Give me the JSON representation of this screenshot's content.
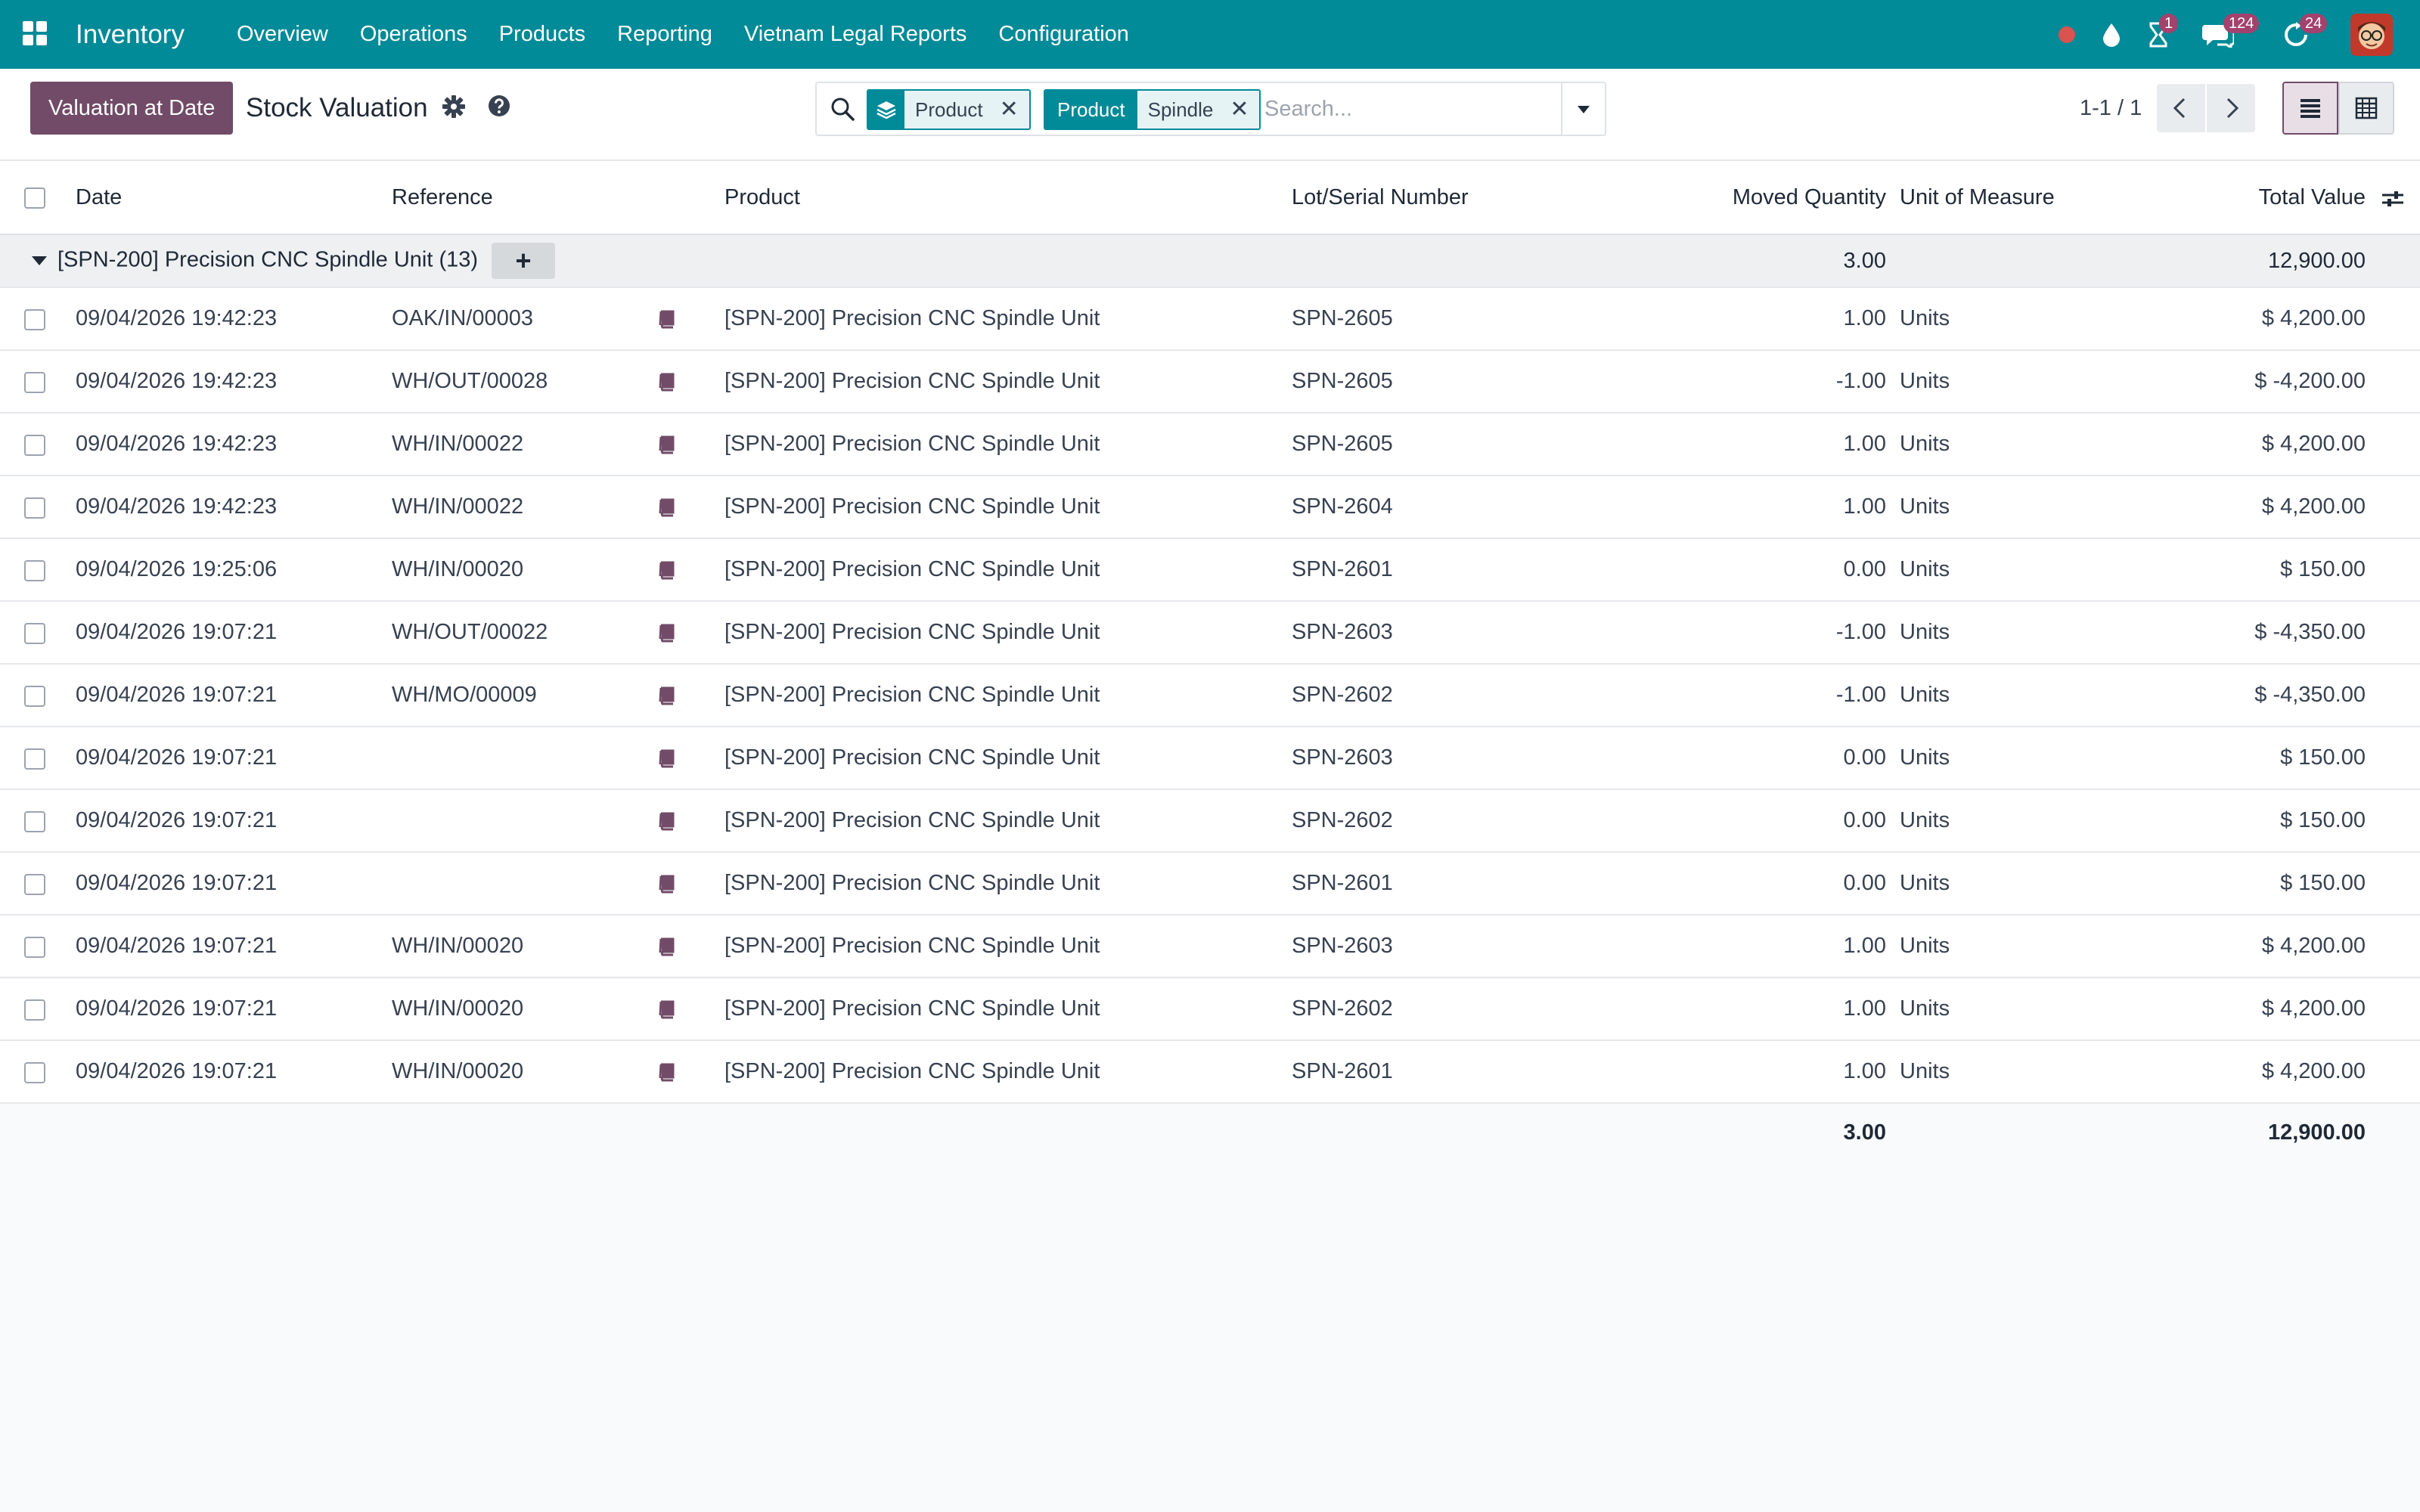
{
  "navbar": {
    "app_name": "Inventory",
    "menu": [
      "Overview",
      "Operations",
      "Products",
      "Reporting",
      "Vietnam Legal Reports",
      "Configuration"
    ],
    "badges": {
      "activities": "1",
      "messages": "124",
      "updates": "24"
    },
    "accent_color": "#018a97"
  },
  "control": {
    "action_button": "Valuation at Date",
    "title": "Stock Valuation",
    "facets": [
      {
        "tag": "",
        "value": "Product"
      },
      {
        "tag": "Product",
        "value": "Spindle"
      }
    ],
    "search_placeholder": "Search...",
    "pager": "1-1 / 1"
  },
  "table": {
    "columns": {
      "date": "Date",
      "reference": "Reference",
      "product": "Product",
      "lot": "Lot/Serial Number",
      "qty": "Moved Quantity",
      "uom": "Unit of Measure",
      "value": "Total Value"
    },
    "group": {
      "label": "[SPN-200] Precision CNC Spindle Unit (13)",
      "qty": "3.00",
      "value": "12,900.00"
    },
    "rows": [
      {
        "date": "09/04/2026 19:42:23",
        "reference": "OAK/IN/00003",
        "product": "[SPN-200] Precision CNC Spindle Unit",
        "lot": "SPN-2605",
        "qty": "1.00",
        "uom": "Units",
        "value": "$ 4,200.00"
      },
      {
        "date": "09/04/2026 19:42:23",
        "reference": "WH/OUT/00028",
        "product": "[SPN-200] Precision CNC Spindle Unit",
        "lot": "SPN-2605",
        "qty": "-1.00",
        "uom": "Units",
        "value": "$ -4,200.00"
      },
      {
        "date": "09/04/2026 19:42:23",
        "reference": "WH/IN/00022",
        "product": "[SPN-200] Precision CNC Spindle Unit",
        "lot": "SPN-2605",
        "qty": "1.00",
        "uom": "Units",
        "value": "$ 4,200.00"
      },
      {
        "date": "09/04/2026 19:42:23",
        "reference": "WH/IN/00022",
        "product": "[SPN-200] Precision CNC Spindle Unit",
        "lot": "SPN-2604",
        "qty": "1.00",
        "uom": "Units",
        "value": "$ 4,200.00"
      },
      {
        "date": "09/04/2026 19:25:06",
        "reference": "WH/IN/00020",
        "product": "[SPN-200] Precision CNC Spindle Unit",
        "lot": "SPN-2601",
        "qty": "0.00",
        "uom": "Units",
        "value": "$ 150.00"
      },
      {
        "date": "09/04/2026 19:07:21",
        "reference": "WH/OUT/00022",
        "product": "[SPN-200] Precision CNC Spindle Unit",
        "lot": "SPN-2603",
        "qty": "-1.00",
        "uom": "Units",
        "value": "$ -4,350.00"
      },
      {
        "date": "09/04/2026 19:07:21",
        "reference": "WH/MO/00009",
        "product": "[SPN-200] Precision CNC Spindle Unit",
        "lot": "SPN-2602",
        "qty": "-1.00",
        "uom": "Units",
        "value": "$ -4,350.00"
      },
      {
        "date": "09/04/2026 19:07:21",
        "reference": "",
        "product": "[SPN-200] Precision CNC Spindle Unit",
        "lot": "SPN-2603",
        "qty": "0.00",
        "uom": "Units",
        "value": "$ 150.00"
      },
      {
        "date": "09/04/2026 19:07:21",
        "reference": "",
        "product": "[SPN-200] Precision CNC Spindle Unit",
        "lot": "SPN-2602",
        "qty": "0.00",
        "uom": "Units",
        "value": "$ 150.00"
      },
      {
        "date": "09/04/2026 19:07:21",
        "reference": "",
        "product": "[SPN-200] Precision CNC Spindle Unit",
        "lot": "SPN-2601",
        "qty": "0.00",
        "uom": "Units",
        "value": "$ 150.00"
      },
      {
        "date": "09/04/2026 19:07:21",
        "reference": "WH/IN/00020",
        "product": "[SPN-200] Precision CNC Spindle Unit",
        "lot": "SPN-2603",
        "qty": "1.00",
        "uom": "Units",
        "value": "$ 4,200.00"
      },
      {
        "date": "09/04/2026 19:07:21",
        "reference": "WH/IN/00020",
        "product": "[SPN-200] Precision CNC Spindle Unit",
        "lot": "SPN-2602",
        "qty": "1.00",
        "uom": "Units",
        "value": "$ 4,200.00"
      },
      {
        "date": "09/04/2026 19:07:21",
        "reference": "WH/IN/00020",
        "product": "[SPN-200] Precision CNC Spindle Unit",
        "lot": "SPN-2601",
        "qty": "1.00",
        "uom": "Units",
        "value": "$ 4,200.00"
      }
    ],
    "totals": {
      "qty": "3.00",
      "value": "12,900.00"
    }
  }
}
